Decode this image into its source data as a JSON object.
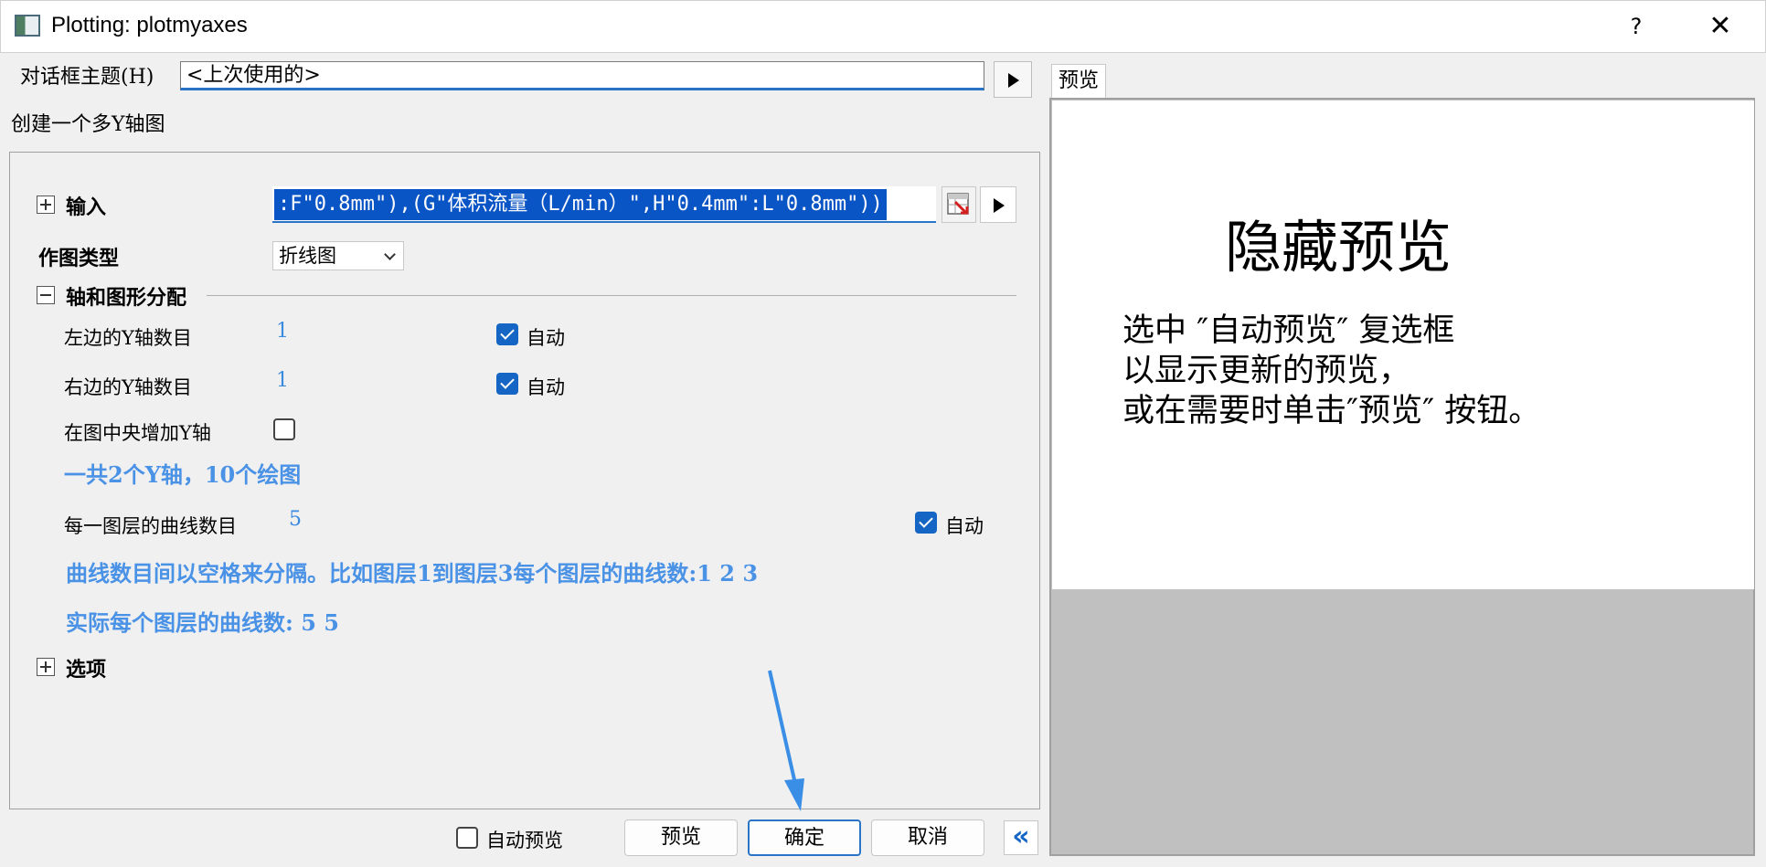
{
  "window": {
    "title": "Plotting: plotmyaxes",
    "help_label": "?",
    "close_label": "✕"
  },
  "theme": {
    "label": "对话框主题(H)",
    "value": "<上次使用的>"
  },
  "description": "创建一个多Y轴图",
  "input": {
    "label": "输入",
    "value": ":F\"0.8mm\"),(G\"体积流量（L/min）\",H\"0.4mm\":L\"0.8mm\"))"
  },
  "plot_type": {
    "label": "作图类型",
    "value": "折线图"
  },
  "axes_group": {
    "label": "轴和图形分配",
    "left_y_label": "左边的Y轴数目",
    "left_y_value": "1",
    "left_y_auto": "自动",
    "right_y_label": "右边的Y轴数目",
    "right_y_value": "1",
    "right_y_auto": "自动",
    "center_y_label": "在图中央增加Y轴",
    "summary": "一共2个Y轴，10个绘图",
    "curves_label": "每一图层的曲线数目",
    "curves_value": "5",
    "curves_auto": "自动",
    "curves_hint": "曲线数目间以空格来分隔。比如图层1到图层3每个图层的曲线数:1 2 3",
    "actual_curves": "实际每个图层的曲线数: 5 5"
  },
  "options": {
    "label": "选项"
  },
  "bottom": {
    "auto_preview_label": "自动预览",
    "preview_button": "预览",
    "ok_button": "确定",
    "cancel_button": "取消",
    "collapse_label": "«"
  },
  "preview": {
    "tab_label": "预览",
    "heading": "隐藏预览",
    "line1": "选中 ″自动预览″ 复选框",
    "line2": "以显示更新的预览，",
    "line3": "或在需要时单击″预览″ 按钮。"
  },
  "colors": {
    "accent": "#1566c4",
    "blue_text": "#4a92e6",
    "annotation_arrow": "#3a8ee6"
  },
  "icons": [
    "app-icon",
    "expand-icon",
    "collapse-icon",
    "select-range-icon",
    "arrow-right-icon",
    "chevron-down-icon",
    "double-chevron-left-icon"
  ]
}
